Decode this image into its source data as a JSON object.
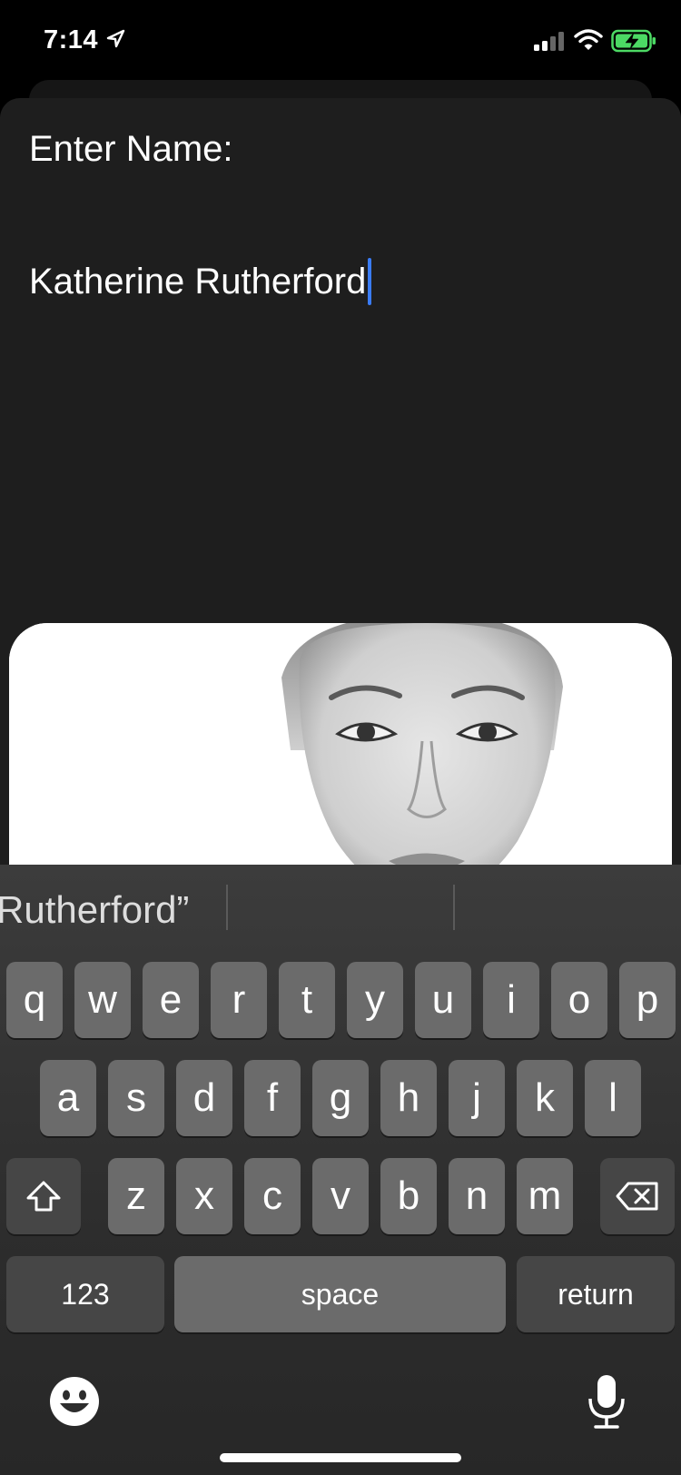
{
  "status_bar": {
    "time": "7:14"
  },
  "form": {
    "prompt": "Enter Name:",
    "name_value": "Katherine Rutherford"
  },
  "keyboard": {
    "suggestion": "Rutherford”",
    "row1": [
      "q",
      "w",
      "e",
      "r",
      "t",
      "y",
      "u",
      "i",
      "o",
      "p"
    ],
    "row2": [
      "a",
      "s",
      "d",
      "f",
      "g",
      "h",
      "j",
      "k",
      "l"
    ],
    "row3": [
      "z",
      "x",
      "c",
      "v",
      "b",
      "n",
      "m"
    ],
    "numbers_label": "123",
    "space_label": "space",
    "return_label": "return"
  },
  "colors": {
    "caret": "#3a7cf6",
    "battery": "#4cd964"
  },
  "icons": [
    "location-arrow-icon",
    "signal-icon",
    "wifi-icon",
    "battery-charging-icon",
    "shift-icon",
    "delete-icon",
    "emoji-icon",
    "microphone-icon"
  ]
}
